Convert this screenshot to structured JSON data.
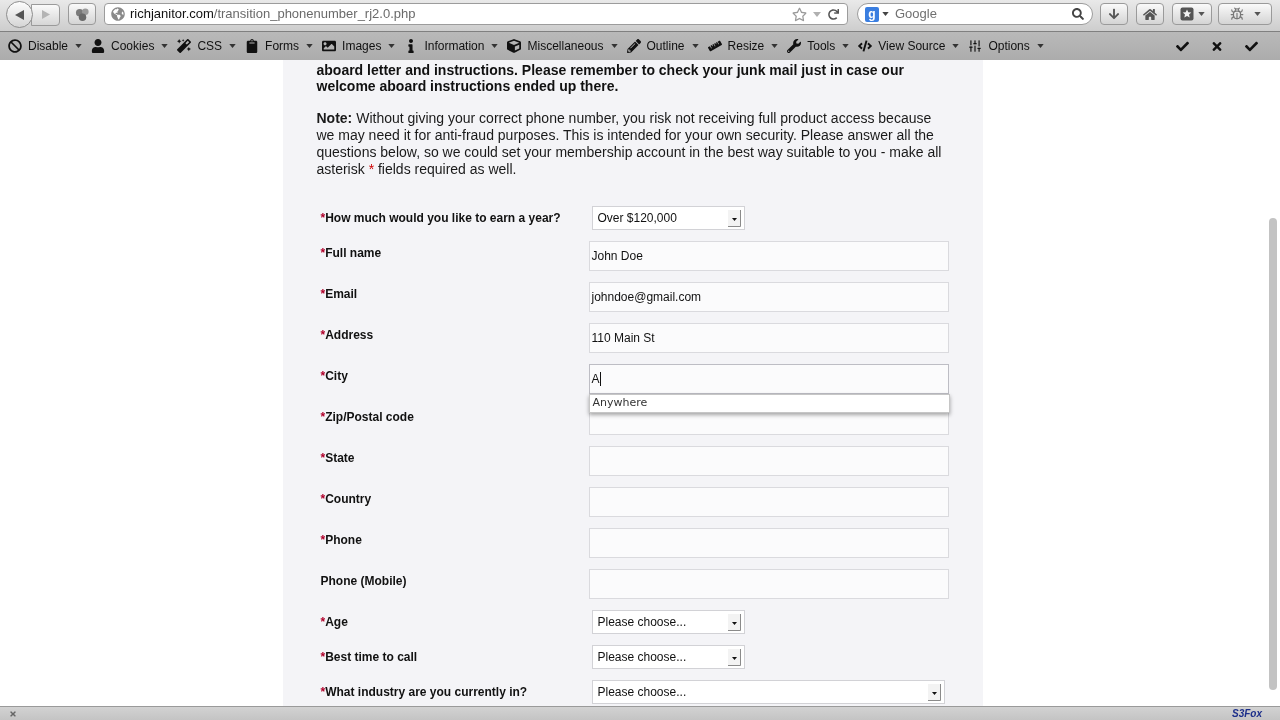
{
  "browser": {
    "nav_buttons": [
      {
        "kind": "back",
        "disabled": false
      },
      {
        "kind": "forward",
        "disabled": true
      }
    ],
    "url": {
      "domain": "richjanitor.com",
      "path": "/transition_phonenumber_rj2.0.php"
    },
    "search": {
      "engine_badge": "g",
      "placeholder": "Google"
    }
  },
  "toolbar": {
    "menus": [
      {
        "label": "Disable"
      },
      {
        "label": "Cookies"
      },
      {
        "label": "CSS"
      },
      {
        "label": "Forms"
      },
      {
        "label": "Images"
      },
      {
        "label": "Information"
      },
      {
        "label": "Miscellaneous"
      },
      {
        "label": "Outline"
      },
      {
        "label": "Resize"
      },
      {
        "label": "Tools"
      },
      {
        "label": "View Source"
      },
      {
        "label": "Options"
      }
    ]
  },
  "page": {
    "intro": "aboard letter and instructions. Please remember to check your junk mail just in case our welcome aboard instructions ended up there.",
    "note": {
      "label": "Note:",
      "text": "Without giving your correct phone number, you risk not receiving full product access because we may need it for anti-fraud purposes. This is intended for your own security. Please answer all the questions below, so we could set your membership account in the best way suitable to you - make all asterisk",
      "mark": "*",
      "tail": "fields required as well."
    },
    "form": {
      "fields": [
        {
          "kind": "select",
          "mark": "*",
          "label": "How much would you like to earn a year?",
          "value": "Over $120,000",
          "focused": false
        },
        {
          "kind": "text",
          "mark": "*",
          "label": "Full name",
          "value": "John Doe",
          "focused": false
        },
        {
          "kind": "text",
          "mark": "*",
          "label": "Email",
          "value": "johndoe@gmail.com",
          "focused": false
        },
        {
          "kind": "text",
          "mark": "*",
          "label": "Address",
          "value": "110 Main St",
          "focused": false
        },
        {
          "kind": "text",
          "mark": "*",
          "label": "City",
          "value": "A",
          "focused": true,
          "suggestions": [
            "Anywhere"
          ]
        },
        {
          "kind": "text",
          "mark": "*",
          "label": "Zip/Postal code",
          "focused": false
        },
        {
          "kind": "text",
          "mark": "*",
          "label": "State",
          "focused": false
        },
        {
          "kind": "text",
          "mark": "*",
          "label": "Country",
          "focused": false
        },
        {
          "kind": "text",
          "mark": "*",
          "label": "Phone",
          "focused": false
        },
        {
          "kind": "text",
          "label": "Phone (Mobile)",
          "focused": false
        },
        {
          "kind": "select",
          "mark": "*",
          "label": "Age",
          "value": "Please choose...",
          "focused": false
        },
        {
          "kind": "select",
          "mark": "*",
          "label": "Best time to call",
          "value": "Please choose...",
          "focused": false
        },
        {
          "kind": "select_wide",
          "mark": "*",
          "label": "What industry are you currently in?",
          "value": "Please choose...",
          "focused": false
        }
      ]
    }
  },
  "status_bar": {
    "addon": "S3Fox"
  }
}
